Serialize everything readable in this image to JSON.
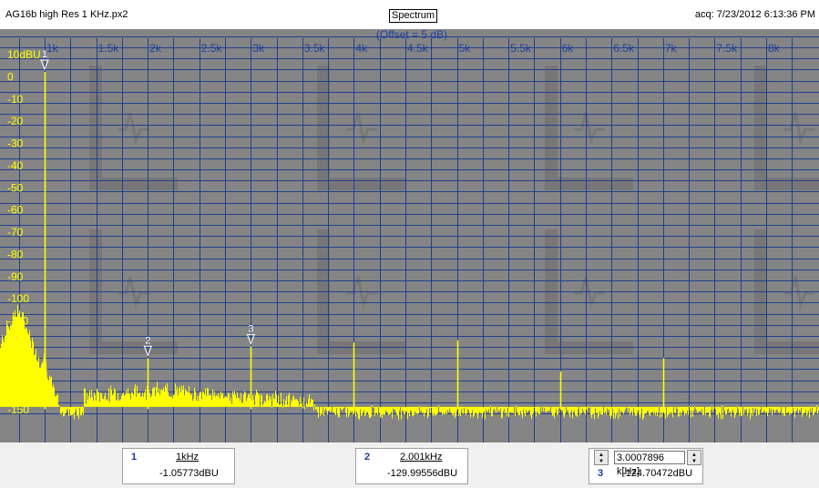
{
  "header": {
    "file_name": "AG16b high Res 1 KHz.px2",
    "view_button": "Spectrum",
    "acquisition": "acq: 7/23/2012 6:13:36 PM"
  },
  "colors": {
    "plot_background": "#858585",
    "grid": "#1f3f8f",
    "trace": "#ffff00",
    "axis_labels_x": "#1f3f9f",
    "axis_labels_y": "#ffff00"
  },
  "chart_data": {
    "type": "line",
    "title": "",
    "offset_label": "(Offset = 5 dB)",
    "ylabel": "10dBU",
    "xlim": [
      850,
      8250
    ],
    "ylim": [
      -162,
      20
    ],
    "x_ticks": [
      1000,
      1500,
      2000,
      2500,
      3000,
      3500,
      4000,
      4500,
      5000,
      5500,
      6000,
      6500,
      7000,
      7500,
      8000
    ],
    "x_tick_labels": [
      "1k",
      "1.5k",
      "2k",
      "2.5k",
      "3k",
      "3.5k",
      "4k",
      "4.5k",
      "5k",
      "5.5k",
      "6k",
      "6.5k",
      "7k",
      "7.5k",
      "8k"
    ],
    "y_ticks": [
      10,
      0,
      -10,
      -20,
      -30,
      -40,
      -50,
      -60,
      -70,
      -80,
      -90,
      -100,
      -110,
      -120,
      -130,
      -140,
      -150
    ],
    "y_tick_labels": [
      "10dBU",
      "0",
      "-10",
      "-20",
      "-30",
      "-40",
      "-50",
      "-60",
      "-70",
      "-80",
      "-90",
      "-100",
      "-110",
      "-120",
      "-130",
      "-140",
      "-150"
    ],
    "grid": true,
    "series": [
      {
        "peaks": [
          {
            "x": 1000,
            "y": -1.06
          },
          {
            "x": 2001,
            "y": -130
          },
          {
            "x": 3000.8,
            "y": -124.7
          },
          {
            "x": 4000,
            "y": -123
          },
          {
            "x": 5000,
            "y": -122
          },
          {
            "x": 6000,
            "y": -136
          },
          {
            "x": 7000,
            "y": -130
          }
        ],
        "noise_floor": -158
      }
    ],
    "markers": [
      {
        "label": "1",
        "x": 1000,
        "y": -1.06
      },
      {
        "label": "2",
        "x": 2001,
        "y": -130
      },
      {
        "label": "3",
        "x": 3000.8,
        "y": -124.7
      }
    ]
  },
  "cursors": [
    {
      "index": "1",
      "frequency": "1kHz",
      "level": "-1.05773dBU"
    },
    {
      "index": "2",
      "frequency": "2.001kHz",
      "level": "-129.99556dBU"
    },
    {
      "index": "3",
      "frequency": "3.0007896 k[Hz]",
      "level": "-124.70472dBU"
    }
  ]
}
